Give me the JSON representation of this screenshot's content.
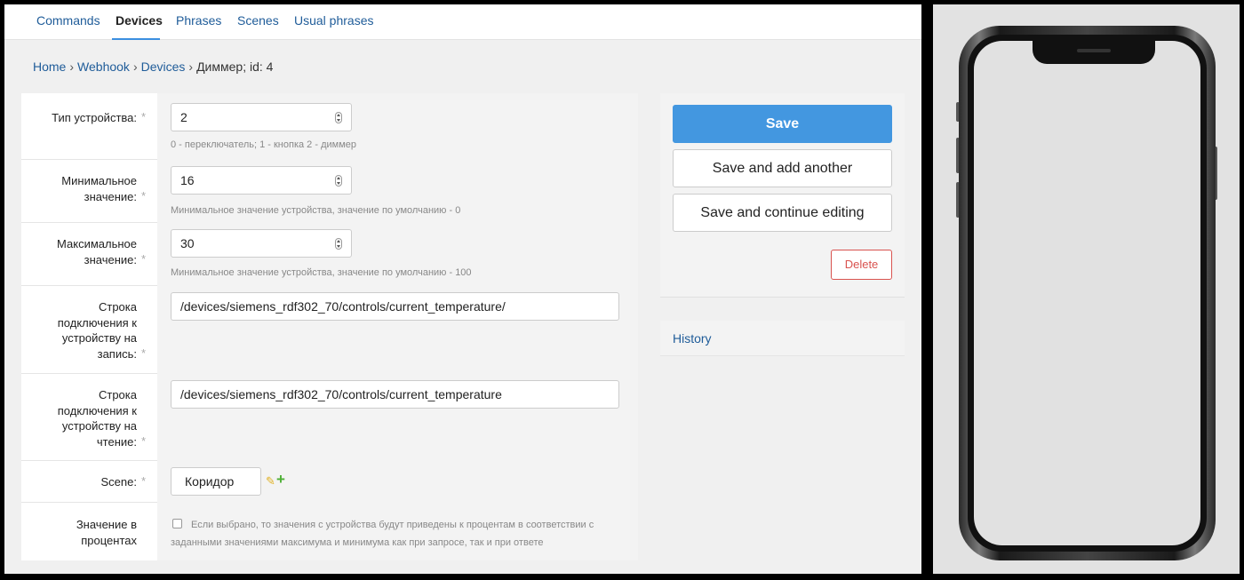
{
  "nav": {
    "tabs": [
      {
        "label": "Commands"
      },
      {
        "label": "Devices"
      },
      {
        "label": "Phrases"
      },
      {
        "label": "Scenes"
      },
      {
        "label": "Usual phrases"
      }
    ],
    "active_tab": "Devices"
  },
  "breadcrumb": {
    "items": [
      "Home",
      "Webhook",
      "Devices"
    ],
    "current": "Диммер; id: 4",
    "separator": "›"
  },
  "form": {
    "required_mark": "*",
    "device_type": {
      "label": "Тип устройства:",
      "value": "2",
      "help": "0 - переключатель; 1 - кнопка 2 - диммер"
    },
    "min_value": {
      "label_line1": "Минимальное",
      "label_line2": "значение:",
      "value": "16",
      "help": "Минимальное значение устройства, значение по умолчанию - 0"
    },
    "max_value": {
      "label_line1": "Максимальное",
      "label_line2": "значение:",
      "value": "30",
      "help": "Минимальное значение устройства, значение по умолчанию - 100"
    },
    "write_conn": {
      "label_line1": "Строка",
      "label_line2": "подключения к",
      "label_line3": "устройству на",
      "label_line4": "запись:",
      "value": "/devices/siemens_rdf302_70/controls/current_temperature/"
    },
    "read_conn": {
      "label_line1": "Строка",
      "label_line2": "подключения к",
      "label_line3": "устройству на",
      "label_line4": "чтение:",
      "value": "/devices/siemens_rdf302_70/controls/current_temperature"
    },
    "scene": {
      "label": "Scene:",
      "value": "Коридор"
    },
    "percent": {
      "label_line1": "Значение в",
      "label_line2": "процентах",
      "checked": false,
      "help": "Если выбрано, то значения с устройства будут приведены к процентам в соответствии с заданными значениями максимума и минимума как при запросе, так и при ответе"
    }
  },
  "actions": {
    "save": "Save",
    "save_add": "Save and add another",
    "save_continue": "Save and continue editing",
    "delete": "Delete",
    "history": "History"
  },
  "colors": {
    "accent": "#4397e0",
    "link": "#1f5c99",
    "danger": "#d9534f"
  }
}
